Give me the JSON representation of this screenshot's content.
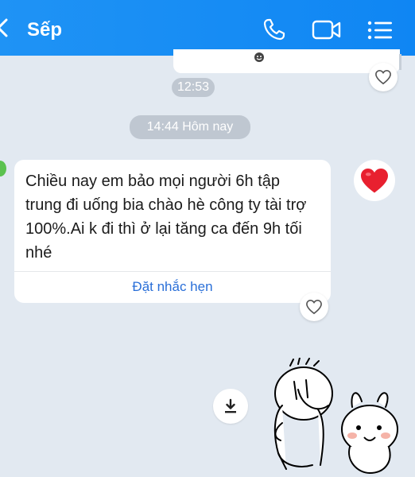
{
  "header": {
    "title": "Sếp",
    "icons": [
      "back-chevron-icon",
      "phone-icon",
      "video-call-icon",
      "list-menu-icon"
    ]
  },
  "prev_message": {
    "time": "12:53",
    "reaction_icon": "emoji-reaction-icon"
  },
  "date_separator": "14:44 Hôm nay",
  "message": {
    "text": "Chiều nay em bảo mọi người 6h tập trung đi uống bia chào hè công ty tài trợ 100%.Ai k đi thì ở lại tăng ca đến 9h tối nhé",
    "action_label": "Đặt nhắc hẹn"
  },
  "reaction": {
    "icon": "red-heart-icon",
    "color": "#e8202f"
  },
  "download_icon": "download-icon",
  "sticker_icon": "cartoon-sticker-icon",
  "colors": {
    "header": "#1a8ff4",
    "background": "#e2e9f1",
    "link": "#2a6fd8"
  }
}
